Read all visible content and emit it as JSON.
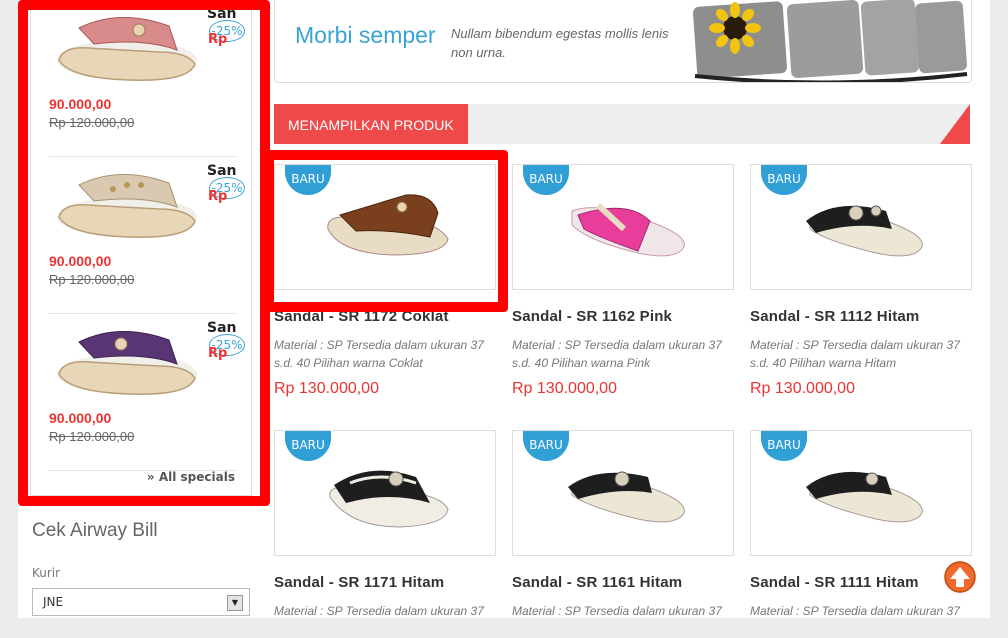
{
  "specials": {
    "items": [
      {
        "name": "Sandal",
        "price": "90.000,00",
        "old_price": "Rp 120.000,00",
        "discount": "-25%",
        "currency": "Rp",
        "color": "#d98b8b",
        "accent": "#c9b58c"
      },
      {
        "name": "Sandal",
        "price": "90.000,00",
        "old_price": "Rp 120.000,00",
        "discount": "-25%",
        "currency": "Rp",
        "color": "#d8c9b0",
        "accent": "#c9b58c"
      },
      {
        "name": "Sandal",
        "price": "90.000,00",
        "old_price": "Rp 120.000,00",
        "discount": "-25%",
        "currency": "Rp",
        "color": "#5a3575",
        "accent": "#c9b58c"
      }
    ],
    "all_link": "» All specials"
  },
  "airway": {
    "title": "Cek Airway Bill",
    "kurir_label": "Kurir",
    "kurir_value": "JNE"
  },
  "banner": {
    "title": "Morbi semper",
    "text": "Nullam bibendum egestas mollis lenis non urna."
  },
  "section": {
    "title": "MENAMPILKAN PRODUK"
  },
  "badge_label": "BARU",
  "products": [
    {
      "name": "Sandal - SR 1172 Coklat",
      "desc": "Material : SP Tersedia dalam ukuran 37 s.d. 40 Pilihan warna Coklat",
      "price": "Rp 130.000,00",
      "color": "#7a3f1c"
    },
    {
      "name": "Sandal - SR 1162 Pink",
      "desc": "Material : SP Tersedia dalam ukuran 37 s.d. 40 Pilihan warna Pink",
      "price": "Rp 130.000,00",
      "color": "#e83d9a"
    },
    {
      "name": "Sandal - SR 1112 Hitam",
      "desc": "Material : SP Tersedia dalam ukuran 37 s.d. 40 Pilihan warna Hitam",
      "price": "Rp 130.000,00",
      "color": "#1e1e1e"
    },
    {
      "name": "Sandal - SR 1171 Hitam",
      "desc": "Material : SP Tersedia dalam ukuran 37",
      "price": "",
      "color": "#1e1e1e"
    },
    {
      "name": "Sandal - SR 1161 Hitam",
      "desc": "Material : SP Tersedia dalam ukuran 37",
      "price": "",
      "color": "#1e1e1e"
    },
    {
      "name": "Sandal - SR 1111 Hitam",
      "desc": "Material : SP Tersedia dalam ukuran 37",
      "price": "",
      "color": "#1e1e1e"
    }
  ],
  "colors": {
    "accent_red": "#ef4a4a",
    "accent_blue": "#2f9fd6",
    "price_red": "#e33333",
    "annotation_red": "#ff0000"
  }
}
